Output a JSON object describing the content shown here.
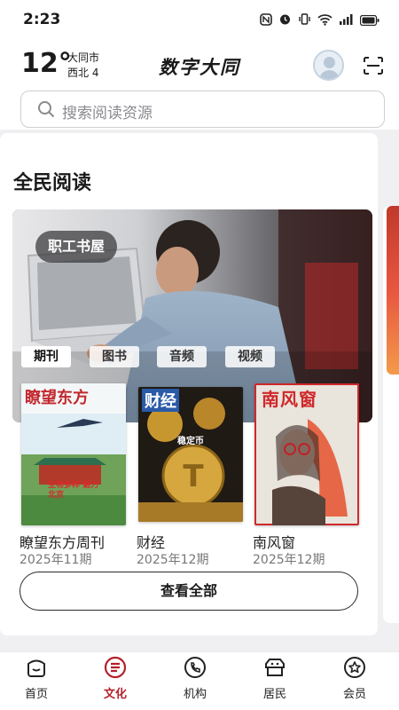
{
  "status_bar": {
    "time": "2:23"
  },
  "weather": {
    "temp": "12°",
    "city": "大同市",
    "wind": "西北 4"
  },
  "app": {
    "title": "数字大同"
  },
  "search": {
    "placeholder": "搜索阅读资源"
  },
  "section": {
    "title": "全民阅读"
  },
  "banner": {
    "tag": "职工书屋"
  },
  "tabs": [
    {
      "label": "期刊",
      "active": true
    },
    {
      "label": "图书",
      "active": false
    },
    {
      "label": "音频",
      "active": false
    },
    {
      "label": "视频",
      "active": false
    }
  ],
  "books": [
    {
      "name": "瞭望东方周刊",
      "issue": "2025年11期",
      "cover_title": "瞭望东方",
      "cover_text": "生物多样 魅力北京"
    },
    {
      "name": "财经",
      "issue": "2025年12期",
      "cover_title": "财经",
      "cover_text": "稳定币"
    },
    {
      "name": "南风窗",
      "issue": "2025年12期",
      "cover_title": "南风窗",
      "cover_text": ""
    }
  ],
  "view_all": {
    "label": "查看全部"
  },
  "tabbar": [
    {
      "label": "首页",
      "icon": "home-icon"
    },
    {
      "label": "文化",
      "icon": "culture-icon",
      "active": true
    },
    {
      "label": "机构",
      "icon": "phone-icon"
    },
    {
      "label": "居民",
      "icon": "resident-icon"
    },
    {
      "label": "会员",
      "icon": "member-icon"
    }
  ],
  "colors": {
    "accent": "#b3202a"
  }
}
